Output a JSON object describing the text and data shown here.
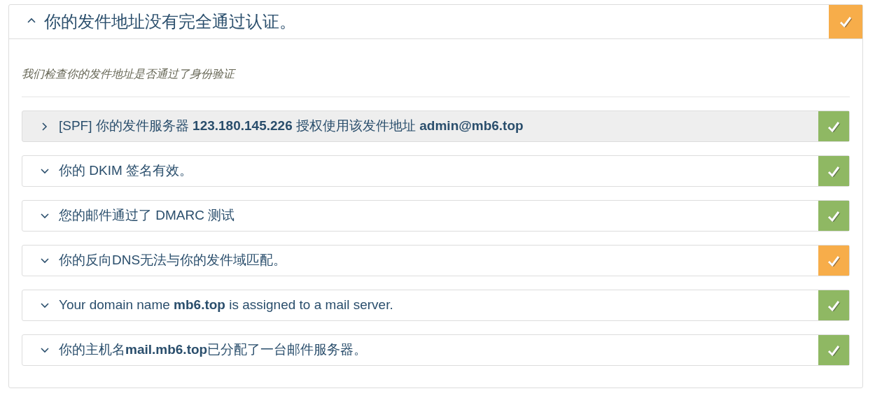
{
  "panel": {
    "title": "你的发件地址没有完全通过认证。",
    "expanded": true,
    "color": "#f7ad4a",
    "subtitle": "我们检查你的发件地址是否通过了身份验证",
    "checks": [
      {
        "text": "[SPF] 你的发件服务器 **123.180.145.226** 授权使用该发件地址 **admin@mb6.top**",
        "selected": true,
        "color": "#8fb863"
      },
      {
        "text": "你的 DKIM 签名有效。",
        "selected": false,
        "color": "#8fb863"
      },
      {
        "text": "您的邮件通过了 DMARC 测试",
        "selected": false,
        "color": "#8fb863"
      },
      {
        "text": "你的反向DNS无法与你的发件域匹配。",
        "selected": false,
        "color": "#f7ad4a"
      },
      {
        "text": "Your domain name **mb6.top** is assigned to a mail server.",
        "selected": false,
        "color": "#8fb863"
      },
      {
        "text": "你的主机名**mail.mb6.top**已分配了一台邮件服务器。",
        "selected": false,
        "color": "#8fb863"
      }
    ]
  }
}
